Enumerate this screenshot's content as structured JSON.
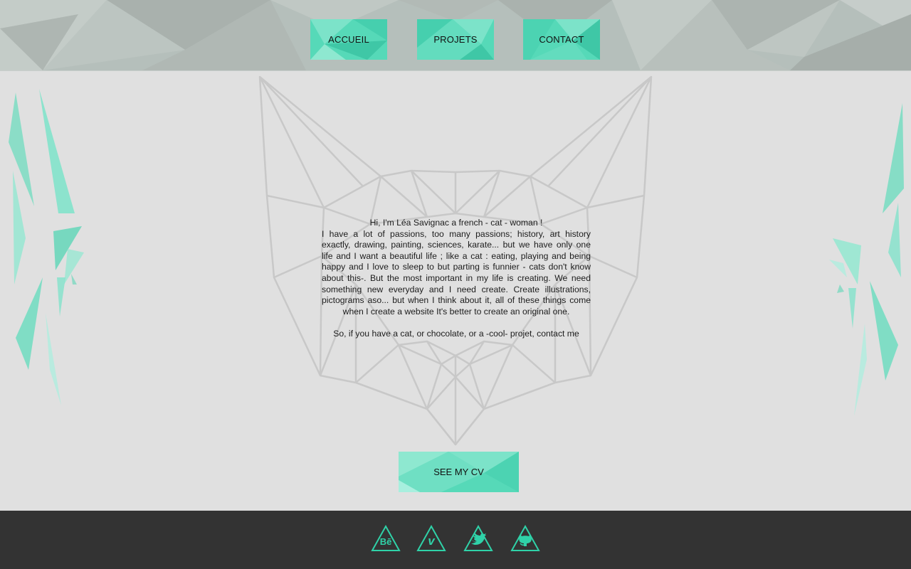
{
  "nav": {
    "accueil": "ACCUEIL",
    "projets": "PROJETS",
    "contact": "CONTACT"
  },
  "bio": {
    "greeting": "Hi, I'm Léa Savignac a french - cat - woman !",
    "paragraph": "I have a lot of passions, too many passions; history, art history exactly, drawing, painting, sciences, karate... but we have only one life and I want a beautiful life ; like a cat : eating, playing and being happy and I love to sleep to but parting is funnier - cats don't know about this-. But the most important in my life is creating. We need something new everyday and I need create. Create illustrations, pictograms aso... but when I think about it, all of these things come when I create a website It's better to create an original one.",
    "closing": "So, if you have a cat, or chocolate, or a -cool- projet, contact me"
  },
  "cv_button": "SEE MY CV",
  "social": [
    {
      "name": "behance",
      "label": "Bē",
      "icon": "behance-icon"
    },
    {
      "name": "vimeo",
      "label": "v",
      "icon": "vimeo-icon"
    },
    {
      "name": "twitter",
      "label": "",
      "icon": "twitter-bird-icon"
    },
    {
      "name": "github",
      "label": "",
      "icon": "github-octocat-icon"
    }
  ],
  "colors": {
    "accent": "#4fd8b6",
    "accent_light": "#8ee8d0",
    "header_bg": "#b5bfbb",
    "body_bg": "#e0e0e0",
    "footer_bg": "#333333",
    "cat_lines": "#c8c8c8"
  }
}
